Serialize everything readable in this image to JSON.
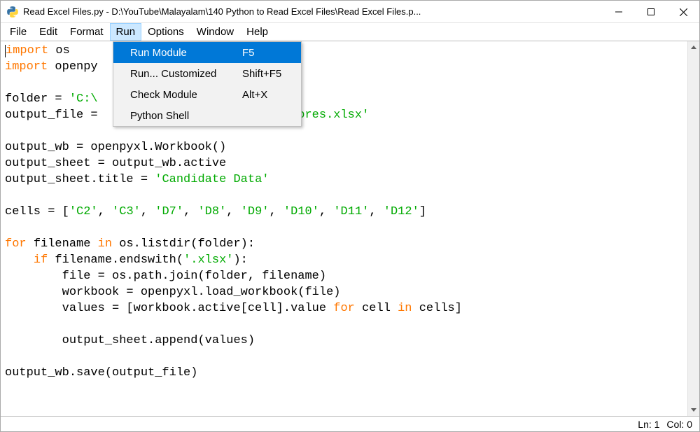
{
  "titlebar": {
    "title": "Read Excel Files.py - D:\\YouTube\\Malayalam\\140 Python to Read Excel Files\\Read Excel Files.p..."
  },
  "menubar": {
    "items": [
      "File",
      "Edit",
      "Format",
      "Run",
      "Options",
      "Window",
      "Help"
    ],
    "active_index": 3
  },
  "dropdown": {
    "items": [
      {
        "label": "Run Module",
        "accel": "F5",
        "selected": true
      },
      {
        "label": "Run... Customized",
        "accel": "Shift+F5",
        "selected": false
      },
      {
        "label": "Check Module",
        "accel": "Alt+X",
        "selected": false
      },
      {
        "label": "Python Shell",
        "accel": "",
        "selected": false
      }
    ]
  },
  "code": {
    "tokens": [
      [
        {
          "t": "import ",
          "c": "kw"
        },
        {
          "t": "os"
        }
      ],
      [
        {
          "t": "import ",
          "c": "kw"
        },
        {
          "t": "openpy"
        }
      ],
      [],
      [
        {
          "t": "folder = "
        },
        {
          "t": "'C:\\",
          "c": "str"
        }
      ],
      [
        {
          "t": "output_file = "
        },
        {
          "t": "                      te Scores.xlsx'",
          "c": "str"
        }
      ],
      [],
      [
        {
          "t": "output_wb = openpyxl.Workbook()"
        }
      ],
      [
        {
          "t": "output_sheet = output_wb.active"
        }
      ],
      [
        {
          "t": "output_sheet.title = "
        },
        {
          "t": "'Candidate Data'",
          "c": "str"
        }
      ],
      [],
      [
        {
          "t": "cells = ["
        },
        {
          "t": "'C2'",
          "c": "str"
        },
        {
          "t": ", "
        },
        {
          "t": "'C3'",
          "c": "str"
        },
        {
          "t": ", "
        },
        {
          "t": "'D7'",
          "c": "str"
        },
        {
          "t": ", "
        },
        {
          "t": "'D8'",
          "c": "str"
        },
        {
          "t": ", "
        },
        {
          "t": "'D9'",
          "c": "str"
        },
        {
          "t": ", "
        },
        {
          "t": "'D10'",
          "c": "str"
        },
        {
          "t": ", "
        },
        {
          "t": "'D11'",
          "c": "str"
        },
        {
          "t": ", "
        },
        {
          "t": "'D12'",
          "c": "str"
        },
        {
          "t": "]"
        }
      ],
      [],
      [
        {
          "t": "for ",
          "c": "kw"
        },
        {
          "t": "filename "
        },
        {
          "t": "in ",
          "c": "kw"
        },
        {
          "t": "os.listdir(folder):"
        }
      ],
      [
        {
          "t": "    "
        },
        {
          "t": "if ",
          "c": "kw"
        },
        {
          "t": "filename.endswith("
        },
        {
          "t": "'.xlsx'",
          "c": "str"
        },
        {
          "t": "):"
        }
      ],
      [
        {
          "t": "        file = os.path.join(folder, filename)"
        }
      ],
      [
        {
          "t": "        workbook = openpyxl.load_workbook(file)"
        }
      ],
      [
        {
          "t": "        values = [workbook.active[cell].value "
        },
        {
          "t": "for ",
          "c": "kw"
        },
        {
          "t": "cell "
        },
        {
          "t": "in ",
          "c": "kw"
        },
        {
          "t": "cells]"
        }
      ],
      [],
      [
        {
          "t": "        output_sheet.append(values)"
        }
      ],
      [],
      [
        {
          "t": "output_wb.save(output_file)"
        }
      ]
    ]
  },
  "status": {
    "line": "Ln: 1",
    "col": "Col: 0"
  }
}
